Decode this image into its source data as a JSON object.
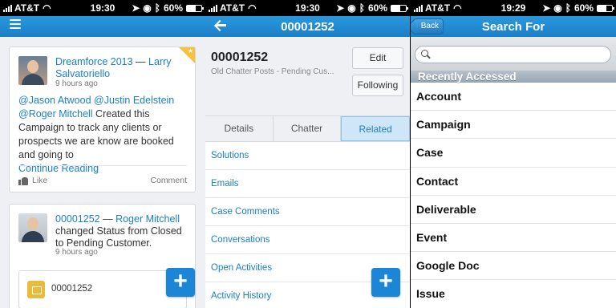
{
  "status_bars": [
    {
      "carrier": "AT&T",
      "time": "19:30",
      "battery": "60%",
      "battery_level": 0.6
    },
    {
      "carrier": "AT&T",
      "time": "19:30",
      "battery": "60%",
      "battery_level": 0.6
    },
    {
      "carrier": "AT&T",
      "time": "19:29",
      "battery": "60%",
      "battery_level": 0.6
    }
  ],
  "feed": {
    "post1": {
      "author": "Dreamforce 2013",
      "separator": " — ",
      "target": "Larry Salvatoriello",
      "time": "9 hours ago",
      "mention1": "@Jason Atwood",
      "mention2": "@Justin Edelstein",
      "mention3": "@Roger Mitchell",
      "text": " Created this Campaign to track any clients or prospects we are know are booked and going to",
      "continue": "Continue Reading",
      "like": "Like",
      "comment": "Comment"
    },
    "post2": {
      "record": "00001252",
      "separator": " — ",
      "author": "Roger Mitchell",
      "text1": "changed ",
      "field": "Status",
      "text2": " from ",
      "from": "Closed",
      "text3": " to ",
      "to": "Pending Customer",
      "end": ".",
      "time": "9 hours ago",
      "attachment": "00001252"
    },
    "fab": "+"
  },
  "detail": {
    "nav_title": "00001252",
    "title": "00001252",
    "subtitle": "Old Chatter Posts - Pending Cus...",
    "edit": "Edit",
    "following": "Following",
    "tabs": [
      "Details",
      "Chatter",
      "Related"
    ],
    "active_tab": "Related",
    "related": [
      "Solutions",
      "Emails",
      "Case Comments",
      "Conversations",
      "Open Activities",
      "Activity History"
    ],
    "fab": "+"
  },
  "search": {
    "nav_title": "Search For",
    "back": "Back",
    "placeholder": "",
    "section": "Recently Accessed",
    "items": [
      "Account",
      "Campaign",
      "Case",
      "Contact",
      "Deliverable",
      "Event",
      "Google Doc",
      "Issue"
    ]
  },
  "colors": {
    "brand": "#1b7fc6",
    "accent_corner": "#f6c23a"
  }
}
